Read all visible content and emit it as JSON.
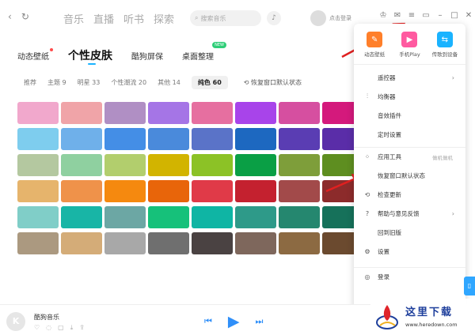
{
  "topbar": {
    "nav": [
      "音乐",
      "直播",
      "听书",
      "探索"
    ],
    "search_placeholder": "搜索音乐",
    "login_text": "点击登录"
  },
  "subtabs": [
    {
      "label": "动态壁纸",
      "active": false
    },
    {
      "label": "个性皮肤",
      "active": true
    },
    {
      "label": "酷狗屏保",
      "active": false
    },
    {
      "label": "桌面整理",
      "active": false
    }
  ],
  "new_badge": "NEW",
  "filters": [
    {
      "label": "推荐",
      "active": false
    },
    {
      "label": "主题 9",
      "active": false
    },
    {
      "label": "明星 33",
      "active": false
    },
    {
      "label": "个性潮流 20",
      "active": false
    },
    {
      "label": "其他 14",
      "active": false
    },
    {
      "label": "纯色 60",
      "active": true
    }
  ],
  "restore_label": "恢复窗口默认状态",
  "swatches": [
    "#f1a8cc",
    "#f0a4a8",
    "#b08fc4",
    "#a575e6",
    "#e66fa0",
    "#a844ea",
    "#d64fa0",
    "#d4197c",
    "#7ecdee",
    "#6fb0ea",
    "#448ee6",
    "#4a8adb",
    "#5a73c8",
    "#1d68c0",
    "#5a3db3",
    "#5a2da8",
    "#b4c8a0",
    "#8fd0a0",
    "#b2ce6d",
    "#d2b400",
    "#8cc226",
    "#0a9f45",
    "#7e9e3a",
    "#5e8e20",
    "#e6b46c",
    "#ef924a",
    "#f5890f",
    "#e8650a",
    "#e03a48",
    "#c4212f",
    "#a24a4a",
    "#8c2b2b",
    "#80cec8",
    "#18b5a6",
    "#6ca7a4",
    "#16c17a",
    "#0fb5a4",
    "#2e9a89",
    "#25876f",
    "#16715a",
    "#ab9980",
    "#d4ac78",
    "#a8a8a8",
    "#6f6f6f",
    "#4a4242",
    "#7e675c",
    "#8c6a42",
    "#6b4a2f"
  ],
  "menu": {
    "quick_actions": [
      {
        "label": "动态壁纸",
        "color": "#ff7f2a",
        "icon": "wallpaper-icon"
      },
      {
        "label": "手机Play",
        "color": "#ff5aa0",
        "icon": "phone-icon"
      },
      {
        "label": "传歌到设备",
        "color": "#1ab3ff",
        "icon": "transfer-icon"
      }
    ],
    "items": [
      {
        "label": "遥控器",
        "icon": "",
        "arrow": "›",
        "hint": ""
      },
      {
        "label": "均衡器",
        "icon": "⫶",
        "arrow": "",
        "hint": ""
      },
      {
        "label": "音效插件",
        "icon": "",
        "arrow": "",
        "hint": ""
      },
      {
        "label": "定时设置",
        "icon": "",
        "arrow": "",
        "hint": ""
      },
      {
        "label": "应用工具",
        "icon": "⁘",
        "arrow": "",
        "hint": "做机做机"
      },
      {
        "label": "恢复窗口默认状态",
        "icon": "",
        "arrow": "",
        "hint": ""
      },
      {
        "label": "检查更新",
        "icon": "⟲",
        "arrow": "",
        "hint": ""
      },
      {
        "label": "帮助与意见反馈",
        "icon": "?",
        "arrow": "›",
        "hint": ""
      },
      {
        "label": "回到旧版",
        "icon": "",
        "arrow": "",
        "hint": ""
      },
      {
        "label": "设置",
        "icon": "⚙",
        "arrow": "",
        "hint": ""
      },
      {
        "label": "登录",
        "icon": "◎",
        "arrow": "",
        "hint": ""
      }
    ]
  },
  "player": {
    "title": "酷狗音乐",
    "logo_letter": "K"
  },
  "watermark": {
    "text": "这里下载",
    "url": "www.heredown.com"
  }
}
